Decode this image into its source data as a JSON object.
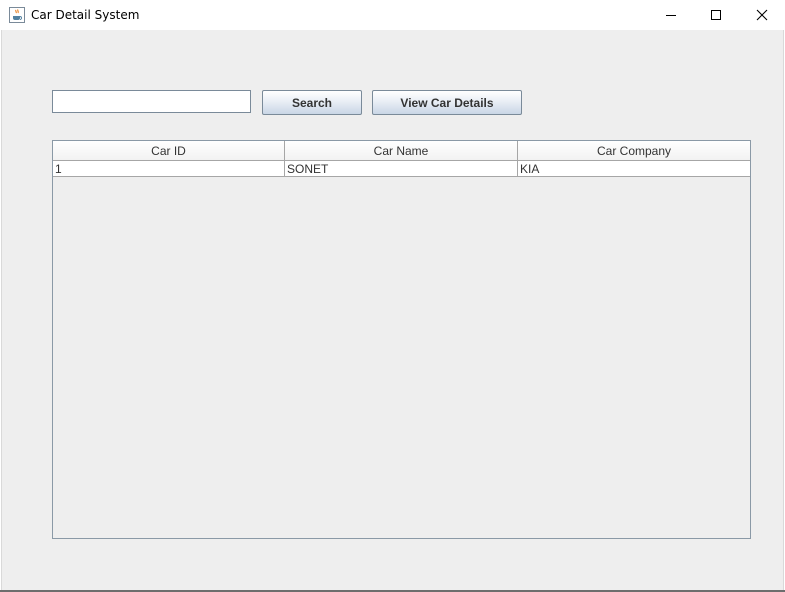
{
  "window": {
    "title": "Car Detail System",
    "icon": "java-cup-icon"
  },
  "controls": {
    "minimize_icon": "minimize-icon",
    "maximize_icon": "maximize-icon",
    "close_icon": "close-icon"
  },
  "search": {
    "value": "",
    "placeholder": "",
    "search_label": "Search",
    "view_label": "View Car Details"
  },
  "table": {
    "columns": [
      "Car ID",
      "Car Name",
      "Car Company"
    ],
    "rows": [
      [
        "1",
        "SONET",
        "KIA"
      ]
    ]
  },
  "colors": {
    "panel_bg": "#eeeeee",
    "button_gradient_bottom": "#c9d6e6",
    "border": "#7a8a99"
  }
}
